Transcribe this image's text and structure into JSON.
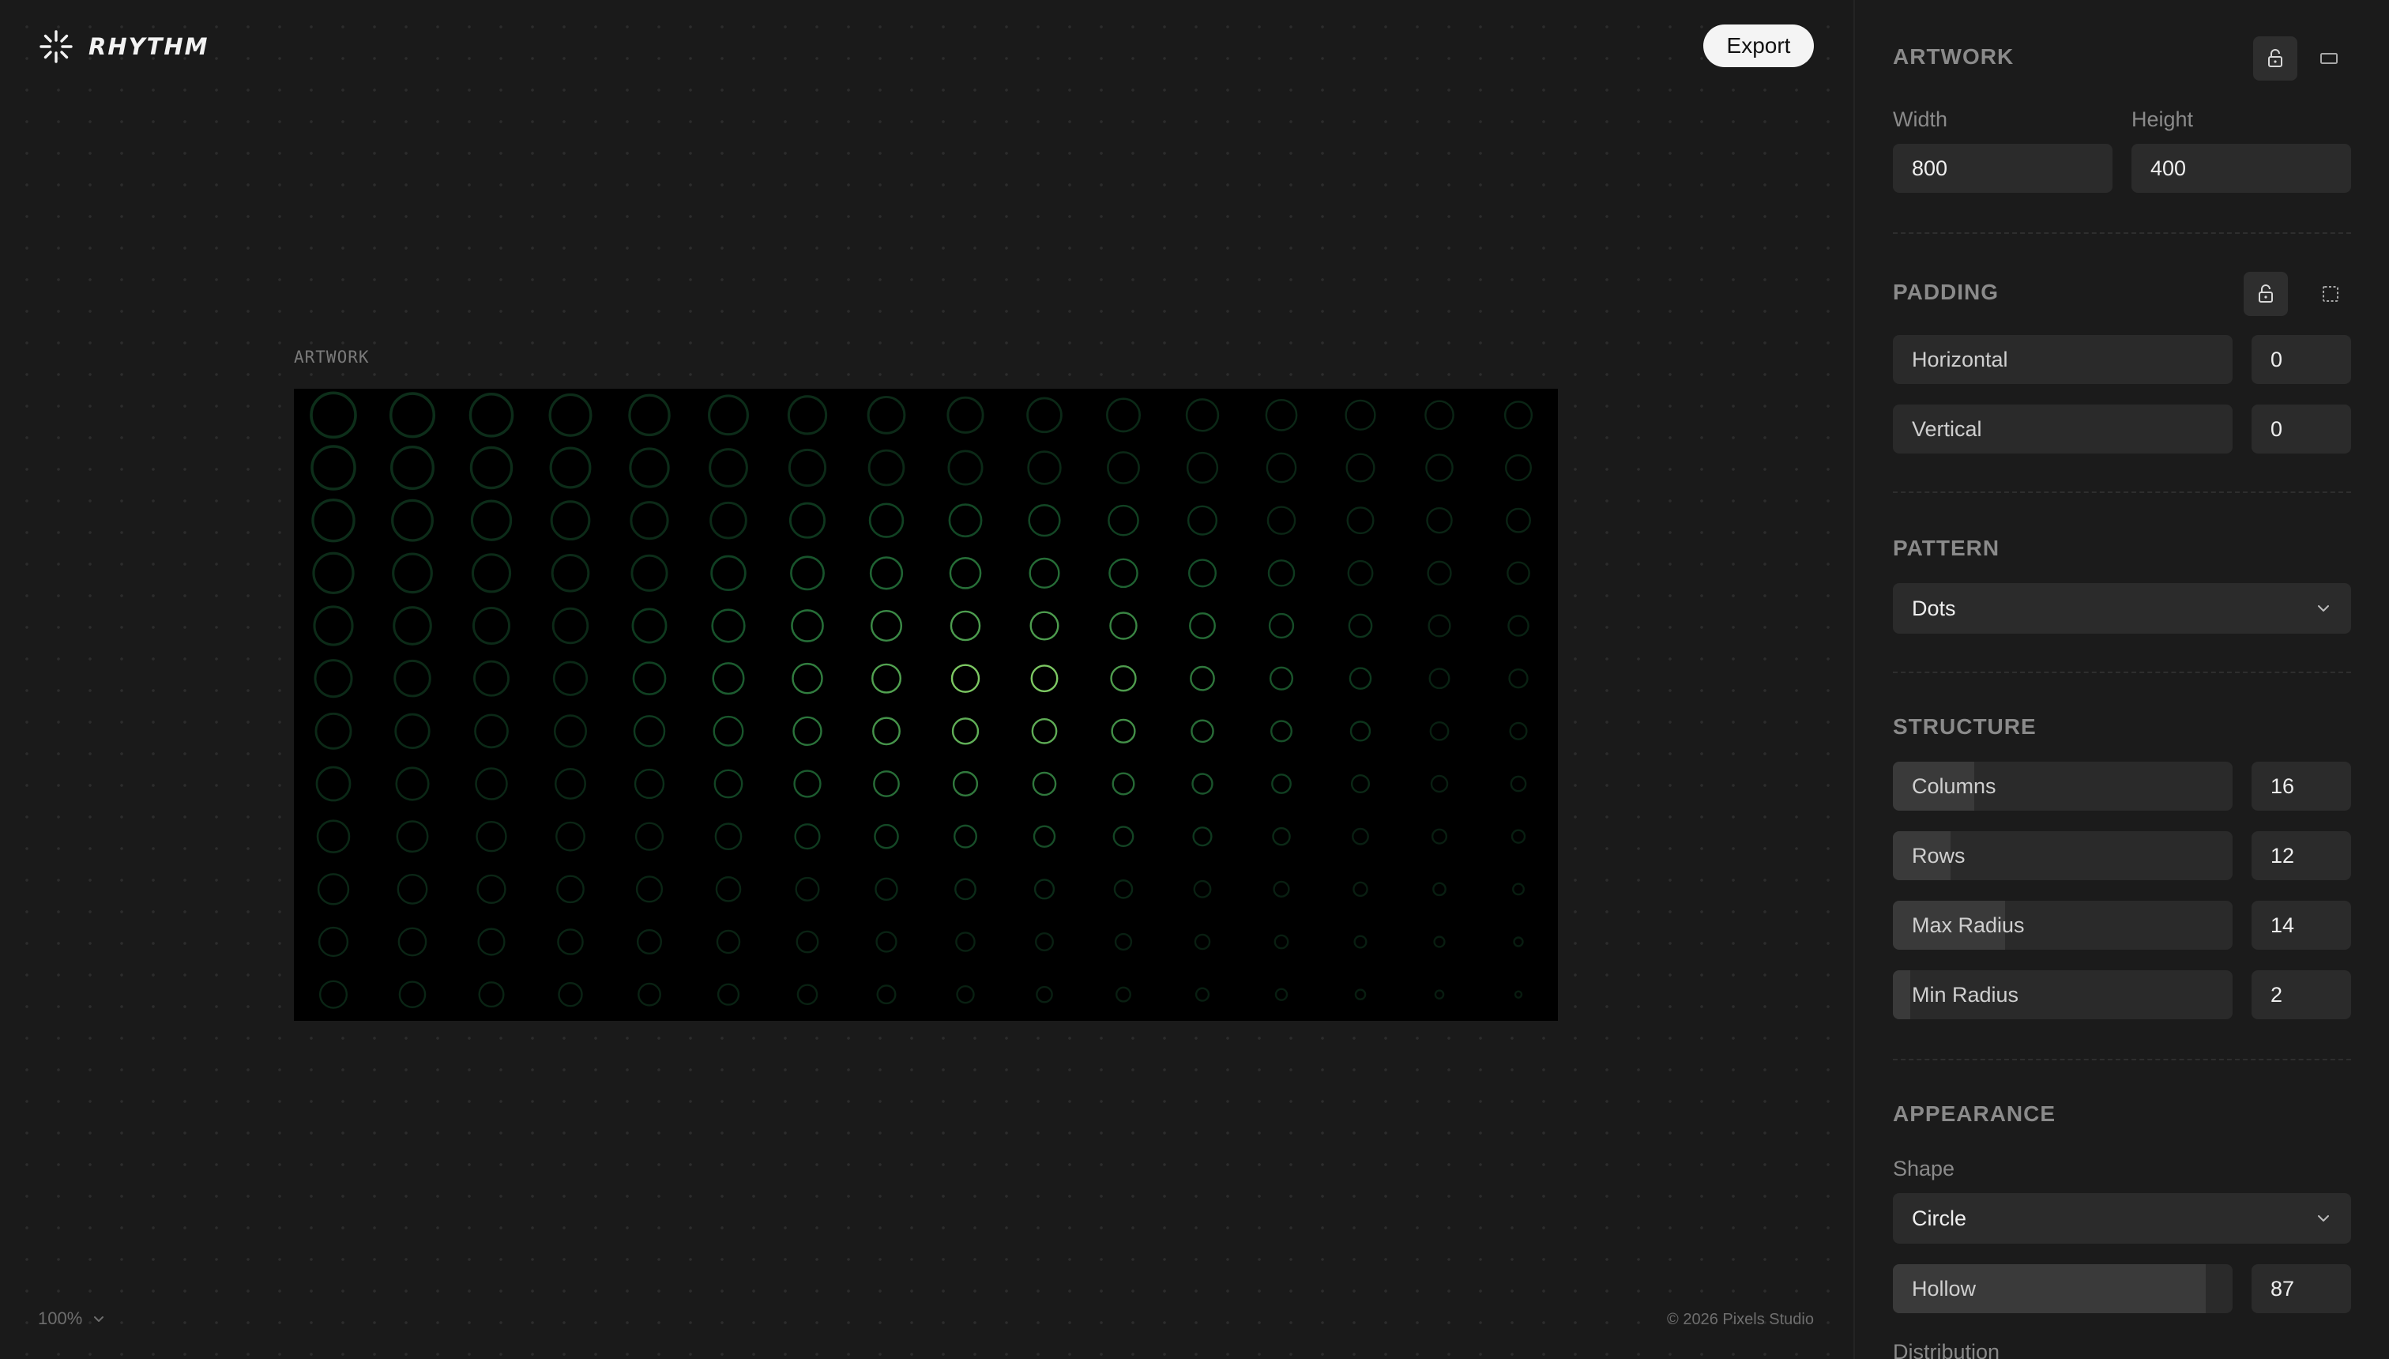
{
  "app": {
    "name": "RHYTHM"
  },
  "toolbar": {
    "export_label": "Export"
  },
  "canvas": {
    "label": "ARTWORK",
    "zoom": "100%"
  },
  "footer": {
    "copyright": "© 2026 Pixels Studio"
  },
  "panel": {
    "artwork": {
      "title": "ARTWORK",
      "width_label": "Width",
      "height_label": "Height",
      "width_value": "800",
      "height_value": "400"
    },
    "padding": {
      "title": "PADDING",
      "horizontal_label": "Horizontal",
      "horizontal_value": "0",
      "vertical_label": "Vertical",
      "vertical_value": "0"
    },
    "pattern": {
      "title": "PATTERN",
      "selected": "Dots"
    },
    "structure": {
      "title": "STRUCTURE",
      "columns_label": "Columns",
      "columns_value": "16",
      "columns_fill": 0.24,
      "rows_label": "Rows",
      "rows_value": "12",
      "rows_fill": 0.17,
      "max_radius_label": "Max Radius",
      "max_radius_value": "14",
      "max_radius_fill": 0.33,
      "min_radius_label": "Min Radius",
      "min_radius_value": "2",
      "min_radius_fill": 0.05
    },
    "appearance": {
      "title": "APPEARANCE",
      "shape_label": "Shape",
      "shape_selected": "Circle",
      "hollow_label": "Hollow",
      "hollow_value": "87",
      "hollow_fill": 0.92,
      "distribution_label": "Distribution"
    }
  },
  "icons": {
    "logo": "burst-icon",
    "lock": "lock-open-icon",
    "aspect": "rectangle-icon",
    "padding": "dashed-square-icon",
    "chevron": "chevron-down-icon"
  },
  "colors": {
    "background": "#1a1a1a",
    "panel": "#1b1b1b",
    "dot_accent": "#8ad58a",
    "dot_base": "#1f5a32"
  },
  "pattern_grid": {
    "columns": 16,
    "rows": 12
  }
}
